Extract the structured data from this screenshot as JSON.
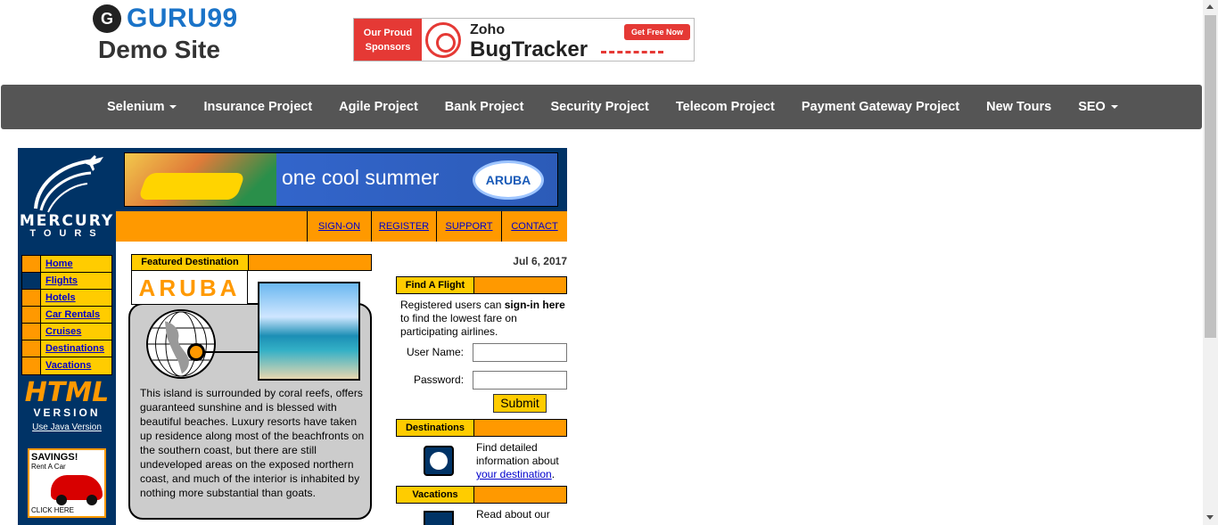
{
  "header": {
    "logo_brand": "GURU99",
    "logo_sub": "Demo Site",
    "logo_mark": "G"
  },
  "sponsor": {
    "left_line1": "Our Proud",
    "left_line2": "Sponsors",
    "brand": "Zoho",
    "product": "BugTracker",
    "cta": "Get Free Now"
  },
  "nav": {
    "items": [
      {
        "label": "Selenium",
        "dropdown": true
      },
      {
        "label": "Insurance Project",
        "dropdown": false
      },
      {
        "label": "Agile Project",
        "dropdown": false
      },
      {
        "label": "Bank Project",
        "dropdown": false
      },
      {
        "label": "Security Project",
        "dropdown": false
      },
      {
        "label": "Telecom Project",
        "dropdown": false
      },
      {
        "label": "Payment Gateway Project",
        "dropdown": false
      },
      {
        "label": "New Tours",
        "dropdown": false
      },
      {
        "label": "SEO",
        "dropdown": true
      }
    ]
  },
  "mercury": {
    "logo_line1": "MERCURY",
    "logo_line2": "TOURS",
    "banner_slogan": "one cool summer",
    "banner_brand": "ARUBA",
    "top_links": [
      "SIGN-ON",
      "REGISTER",
      "SUPPORT",
      "CONTACT"
    ],
    "side_menu": [
      "Home",
      "Flights",
      "Hotels",
      "Car Rentals",
      "Cruises",
      "Destinations",
      "Vacations"
    ],
    "html_version": "HTML",
    "html_version_sub": "VERSION",
    "java_link": "Use Java Version",
    "savings_title": "SAVINGS!",
    "savings_sub": "Rent A Car",
    "savings_click": "CLICK HERE"
  },
  "featured": {
    "header": "Featured Destination",
    "title": "ARUBA",
    "description": "This island is surrounded by coral reefs, offers guaranteed sunshine and is blessed with beautiful beaches. Luxury resorts have taken up residence along most of the beachfronts on the southern coast, but there are still undeveloped areas on the exposed northern coast, and much of the interior is inhabited by nothing more substantial than goats."
  },
  "date": "Jul 6, 2017",
  "find_flight": {
    "header": "Find A Flight",
    "text_pre": "Registered users can ",
    "text_bold": "sign-in here",
    "text_post": " to find the lowest fare on participating airlines.",
    "username_label": "User Name:",
    "password_label": "Password:",
    "username_value": "",
    "password_value": "",
    "submit_label": "Submit"
  },
  "destinations": {
    "header": "Destinations",
    "text": "Find detailed information about ",
    "link": "your destination",
    "suffix": "."
  },
  "vacations": {
    "header": "Vacations",
    "text": "Read about our"
  },
  "colors": {
    "nav_bg": "#555555",
    "mercury_navy": "#003366",
    "mercury_orange": "#ff9900",
    "mercury_yellow": "#ffcc00",
    "brand_blue": "#1a73c8",
    "sponsor_red": "#e53935"
  }
}
